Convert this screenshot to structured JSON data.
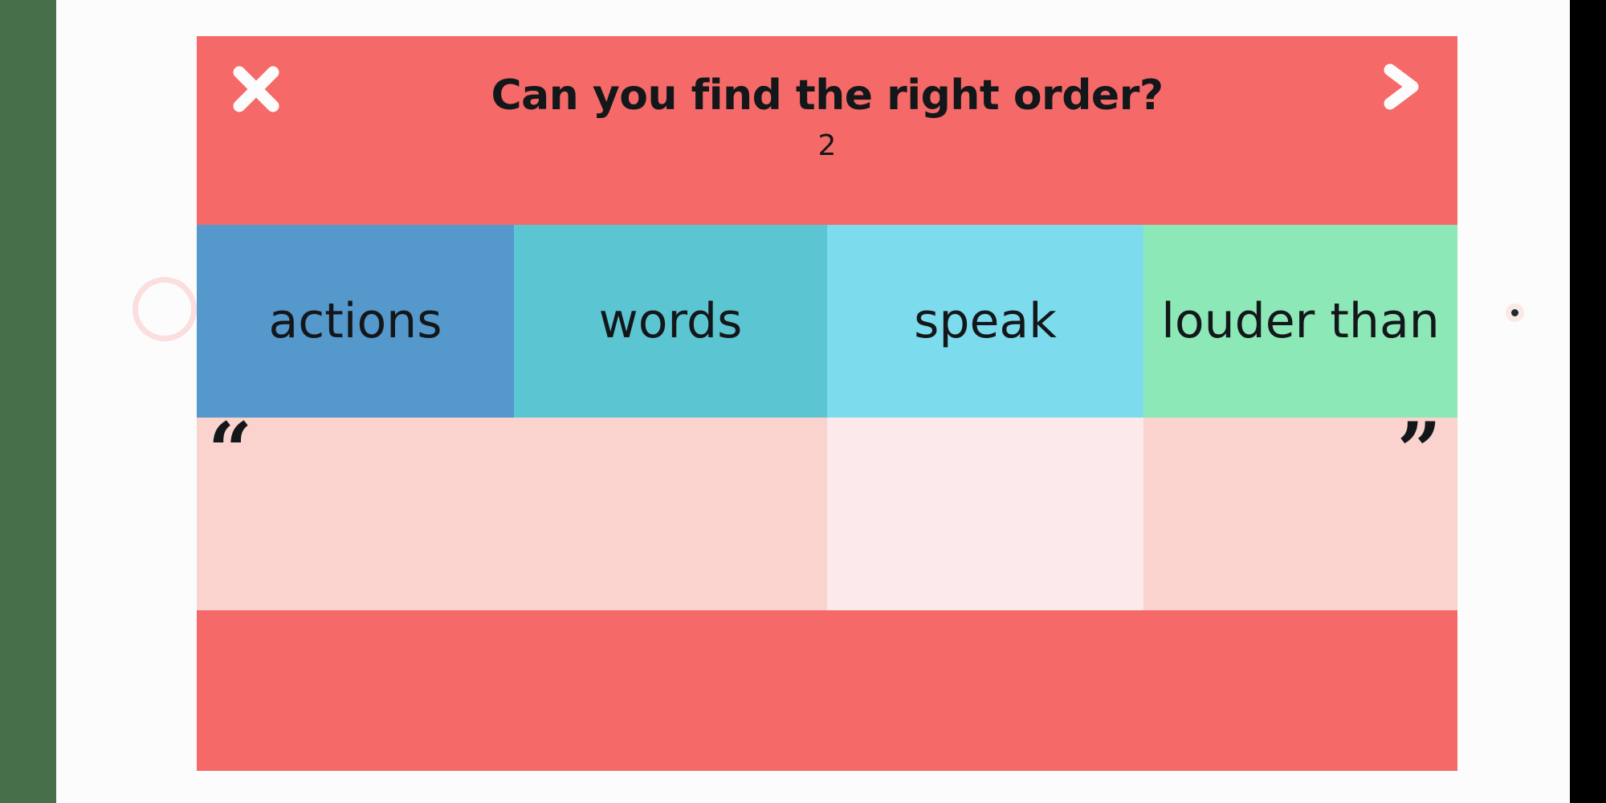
{
  "decor": {
    "left_band_color": "#467049",
    "right_band_color": "#000000",
    "circle_color": "#fbdedd",
    "dot_color": "#1d2b2e"
  },
  "header": {
    "background": "#f56a68",
    "title": "Can you find the right order?",
    "counter": "2",
    "close_icon": "close-x-icon",
    "next_icon": "chevron-right-icon",
    "icon_color": "#fcfcfc"
  },
  "tiles": [
    {
      "label": "actions",
      "color": "#5498cc"
    },
    {
      "label": "words",
      "color": "#5cc5d2"
    },
    {
      "label": "speak",
      "color": "#7cdcee"
    },
    {
      "label": "louder than",
      "color": "#8ce9b7"
    }
  ],
  "drop_zone": {
    "cells": [
      {
        "value": "",
        "color": "#fad2ce",
        "quote": "“",
        "quote_position": "open"
      },
      {
        "value": "",
        "color": "#fad2ce",
        "quote": "",
        "quote_position": "none"
      },
      {
        "value": "",
        "color": "#fce9e9",
        "quote": "",
        "quote_position": "none"
      },
      {
        "value": "",
        "color": "#fad2ce",
        "quote": "”",
        "quote_position": "close"
      }
    ]
  },
  "footer": {
    "background": "#f56a68"
  }
}
